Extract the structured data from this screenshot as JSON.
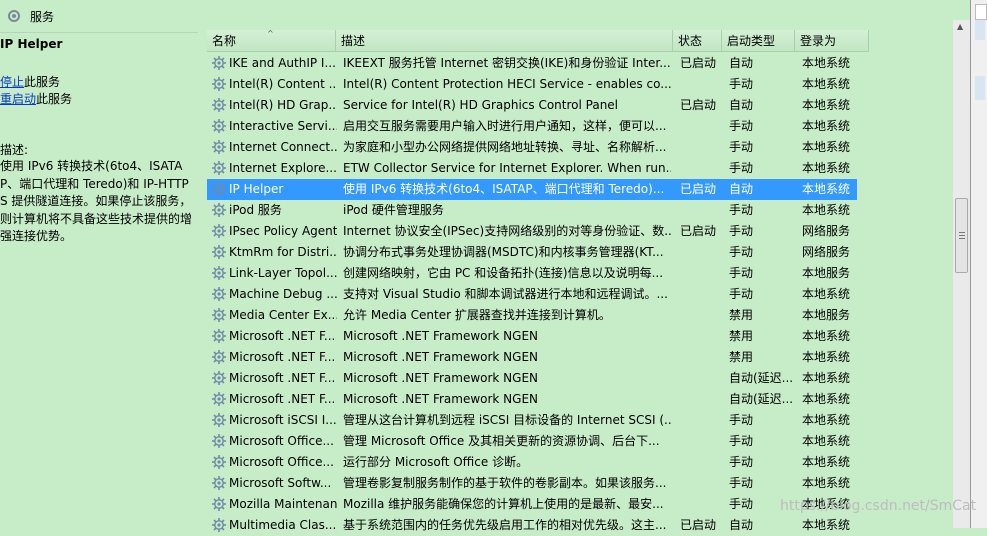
{
  "window": {
    "title": "服务"
  },
  "left_pane": {
    "service_name": "IP Helper",
    "actions": [
      {
        "link": "停止",
        "suffix": "此服务"
      },
      {
        "link": "重启动",
        "suffix": "此服务"
      }
    ],
    "description_label": "描述:",
    "description": "使用 IPv6 转换技术(6to4、ISATAP、端口代理和 Teredo)和 IP-HTTPS 提供隧道连接。如果停止该服务，则计算机将不具备这些技术提供的增强连接优势。"
  },
  "table": {
    "columns": [
      "名称",
      "描述",
      "状态",
      "启动类型",
      "登录为"
    ],
    "sort_indicator": "^",
    "selected_index": 6,
    "rows": [
      {
        "name": "IKE and AuthIP I...",
        "desc": "IKEEXT 服务托管 Internet 密钥交换(IKE)和身份验证 Inter...",
        "status": "已启动",
        "startup": "自动",
        "logon": "本地系统"
      },
      {
        "name": "Intel(R) Content ...",
        "desc": "Intel(R) Content Protection HECI Service - enables co...",
        "status": "",
        "startup": "手动",
        "logon": "本地系统"
      },
      {
        "name": "Intel(R) HD Grap...",
        "desc": "Service for Intel(R) HD Graphics Control Panel",
        "status": "已启动",
        "startup": "自动",
        "logon": "本地系统"
      },
      {
        "name": "Interactive Servi...",
        "desc": "启用交互服务需要用户输入时进行用户通知，这样，便可以...",
        "status": "",
        "startup": "手动",
        "logon": "本地系统"
      },
      {
        "name": "Internet Connect...",
        "desc": "为家庭和小型办公网络提供网络地址转换、寻址、名称解析...",
        "status": "",
        "startup": "手动",
        "logon": "本地系统"
      },
      {
        "name": "Internet Explore...",
        "desc": "ETW Collector Service for Internet Explorer. When run...",
        "status": "",
        "startup": "手动",
        "logon": "本地系统"
      },
      {
        "name": "IP Helper",
        "desc": "使用 IPv6 转换技术(6to4、ISATAP、端口代理和 Teredo)...",
        "status": "已启动",
        "startup": "自动",
        "logon": "本地系统"
      },
      {
        "name": "iPod 服务",
        "desc": "iPod 硬件管理服务",
        "status": "",
        "startup": "手动",
        "logon": "本地系统"
      },
      {
        "name": "IPsec Policy Agent",
        "desc": "Internet 协议安全(IPSec)支持网络级别的对等身份验证、数...",
        "status": "已启动",
        "startup": "手动",
        "logon": "网络服务"
      },
      {
        "name": "KtmRm for Distri...",
        "desc": "协调分布式事务处理协调器(MSDTC)和内核事务管理器(KT...",
        "status": "",
        "startup": "手动",
        "logon": "网络服务"
      },
      {
        "name": "Link-Layer Topol...",
        "desc": "创建网络映射，它由 PC 和设备拓扑(连接)信息以及说明每...",
        "status": "",
        "startup": "手动",
        "logon": "本地服务"
      },
      {
        "name": "Machine Debug ...",
        "desc": "支持对 Visual Studio 和脚本调试器进行本地和远程调试。...",
        "status": "",
        "startup": "手动",
        "logon": "本地系统"
      },
      {
        "name": "Media Center Ex...",
        "desc": "允许 Media Center 扩展器查找并连接到计算机。",
        "status": "",
        "startup": "禁用",
        "logon": "本地服务"
      },
      {
        "name": "Microsoft .NET F...",
        "desc": "Microsoft .NET Framework NGEN",
        "status": "",
        "startup": "禁用",
        "logon": "本地系统"
      },
      {
        "name": "Microsoft .NET F...",
        "desc": "Microsoft .NET Framework NGEN",
        "status": "",
        "startup": "禁用",
        "logon": "本地系统"
      },
      {
        "name": "Microsoft .NET F...",
        "desc": "Microsoft .NET Framework NGEN",
        "status": "",
        "startup": "自动(延迟...",
        "logon": "本地系统"
      },
      {
        "name": "Microsoft .NET F...",
        "desc": "Microsoft .NET Framework NGEN",
        "status": "",
        "startup": "自动(延迟...",
        "logon": "本地系统"
      },
      {
        "name": "Microsoft iSCSI I...",
        "desc": "管理从这台计算机到远程 iSCSI 目标设备的 Internet SCSI (...",
        "status": "",
        "startup": "手动",
        "logon": "本地系统"
      },
      {
        "name": "Microsoft Office...",
        "desc": "管理 Microsoft Office 及其相关更新的资源协调、后台下...",
        "status": "",
        "startup": "手动",
        "logon": "本地系统"
      },
      {
        "name": "Microsoft Office...",
        "desc": "运行部分 Microsoft Office 诊断。",
        "status": "",
        "startup": "手动",
        "logon": "本地系统"
      },
      {
        "name": "Microsoft Softw...",
        "desc": "管理卷影复制服务制作的基于软件的卷影副本。如果该服务...",
        "status": "",
        "startup": "手动",
        "logon": "本地系统"
      },
      {
        "name": "Mozilla Maintenan...",
        "desc": "Mozilla 维护服务能确保您的计算机上使用的是最新、最安...",
        "status": "",
        "startup": "手动",
        "logon": "本地系统"
      },
      {
        "name": "Multimedia Clas...",
        "desc": "基于系统范围内的任务优先级启用工作的相对优先级。这主...",
        "status": "已启动",
        "startup": "自动",
        "logon": "本地系统"
      }
    ]
  },
  "watermark": "https://blog.csdn.net/SmCat"
}
